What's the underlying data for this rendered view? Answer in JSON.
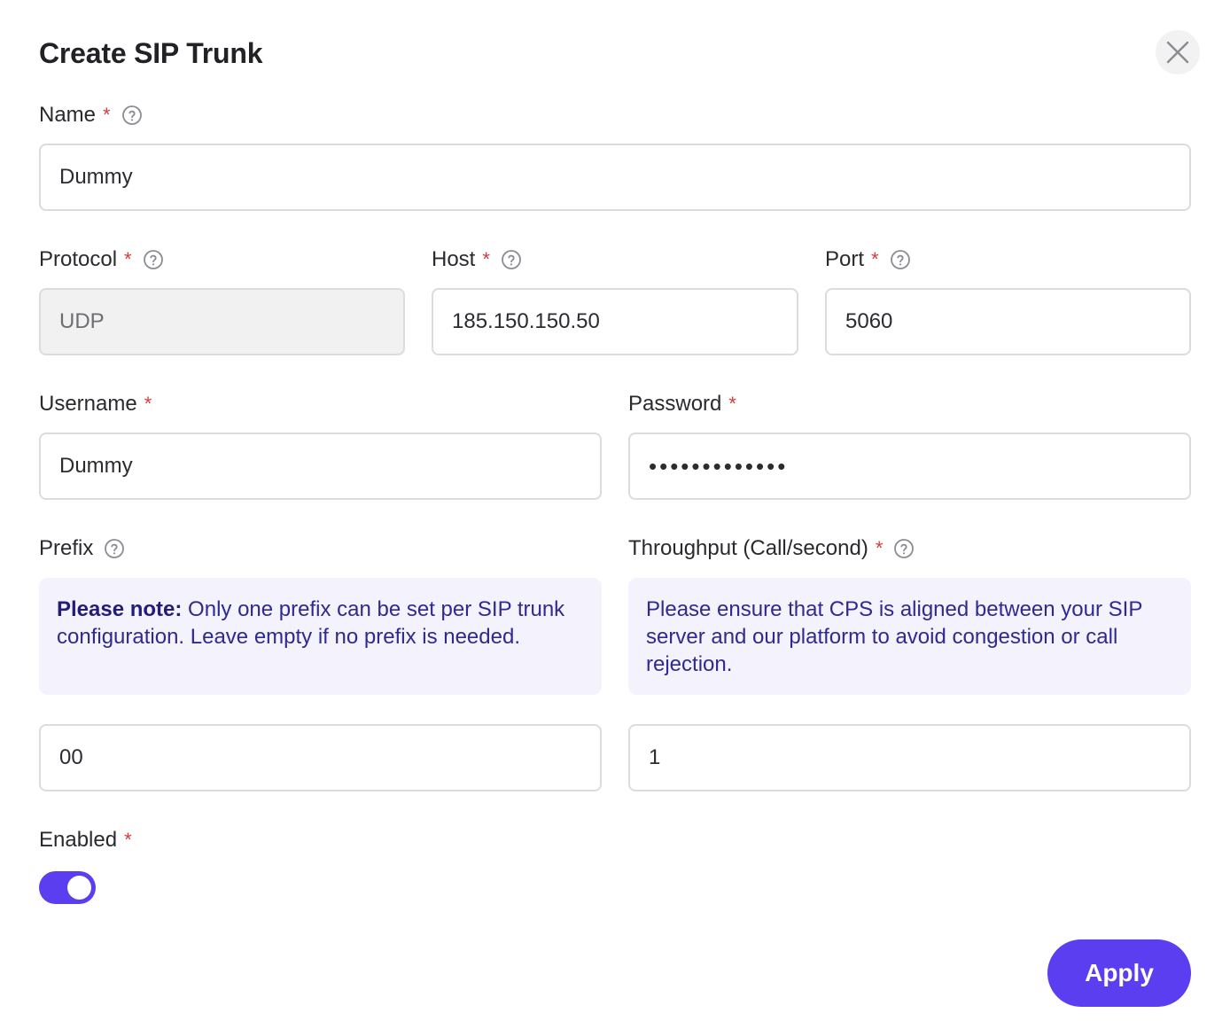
{
  "dialog": {
    "title": "Create SIP Trunk"
  },
  "fields": {
    "name": {
      "label": "Name",
      "required": "*",
      "value": "Dummy"
    },
    "protocol": {
      "label": "Protocol",
      "required": "*",
      "value": "UDP"
    },
    "host": {
      "label": "Host",
      "required": "*",
      "value": "185.150.150.50"
    },
    "port": {
      "label": "Port",
      "required": "*",
      "value": "5060"
    },
    "username": {
      "label": "Username",
      "required": "*",
      "value": "Dummy"
    },
    "password": {
      "label": "Password",
      "required": "*",
      "value": "•••••••••••••"
    },
    "prefix": {
      "label": "Prefix",
      "value": "00",
      "note_bold": "Please note:",
      "note_text": " Only one prefix can be set per SIP trunk configuration. Leave empty if no prefix is needed."
    },
    "throughput": {
      "label": "Throughput (Call/second)",
      "required": "*",
      "value": "1",
      "note_text": "Please ensure that CPS is aligned between your SIP server and our platform to avoid congestion or call rejection."
    },
    "enabled": {
      "label": "Enabled",
      "required": "*",
      "on": true
    }
  },
  "actions": {
    "apply_label": "Apply"
  },
  "colors": {
    "accent": "#5a3ef0",
    "required": "#d93a3a",
    "note_bg": "#f3f2fd",
    "note_text": "#2f2a8f"
  },
  "icons": {
    "close": "close-icon",
    "help": "help-circle-icon"
  }
}
